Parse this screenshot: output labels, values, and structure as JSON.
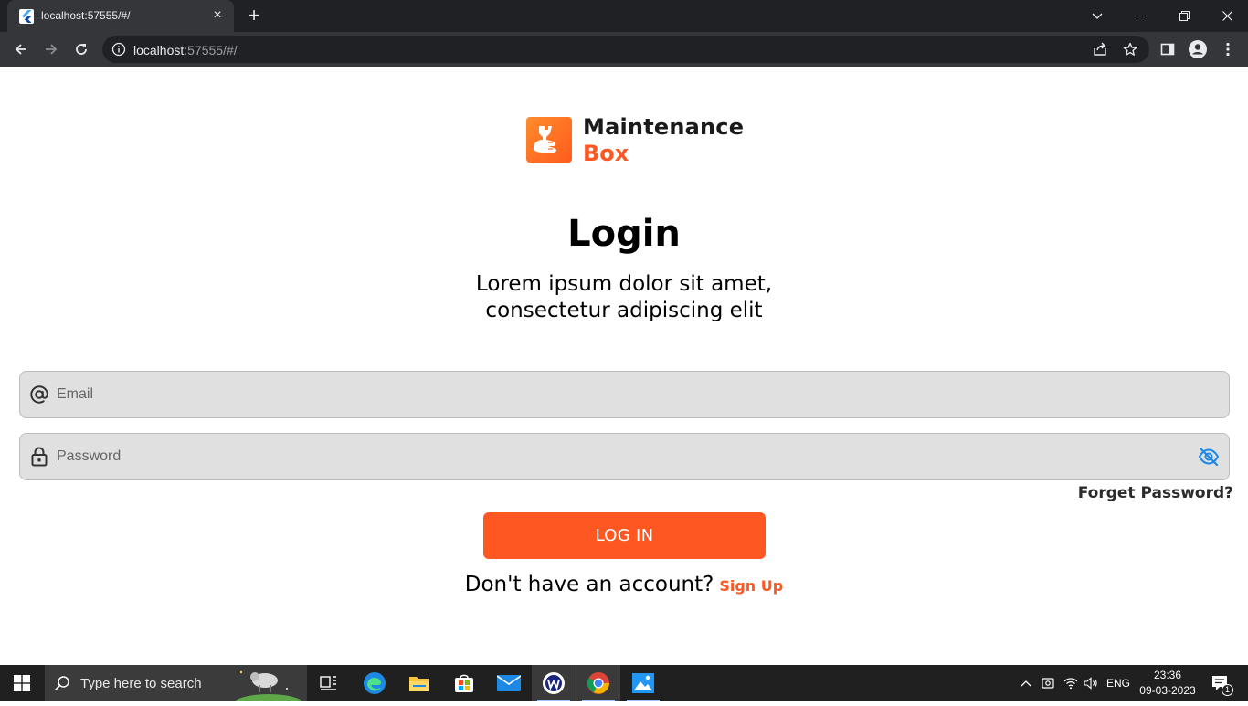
{
  "browser": {
    "tab_title": "localhost:57555/#/",
    "url_host": "localhost",
    "url_rest": ":57555/#/"
  },
  "logo": {
    "line1": "Maintenance",
    "line2": "Box"
  },
  "login": {
    "title": "Login",
    "subtitle_line1": "Lorem ipsum dolor sit amet,",
    "subtitle_line2": "consectetur adipiscing elit",
    "email_placeholder": "Email",
    "password_placeholder": "Password",
    "forgot_label": "Forget Password?",
    "button_label": "LOG IN",
    "no_account_text": "Don't have an account?",
    "signup_label": "Sign Up"
  },
  "taskbar": {
    "search_placeholder": "Type here to search",
    "language": "ENG",
    "time": "23:36",
    "date": "09-03-2023",
    "notification_count": "1"
  },
  "colors": {
    "accent": "#ff5722",
    "field_bg": "#e0e0e0",
    "eye_icon": "#1e88e5"
  }
}
